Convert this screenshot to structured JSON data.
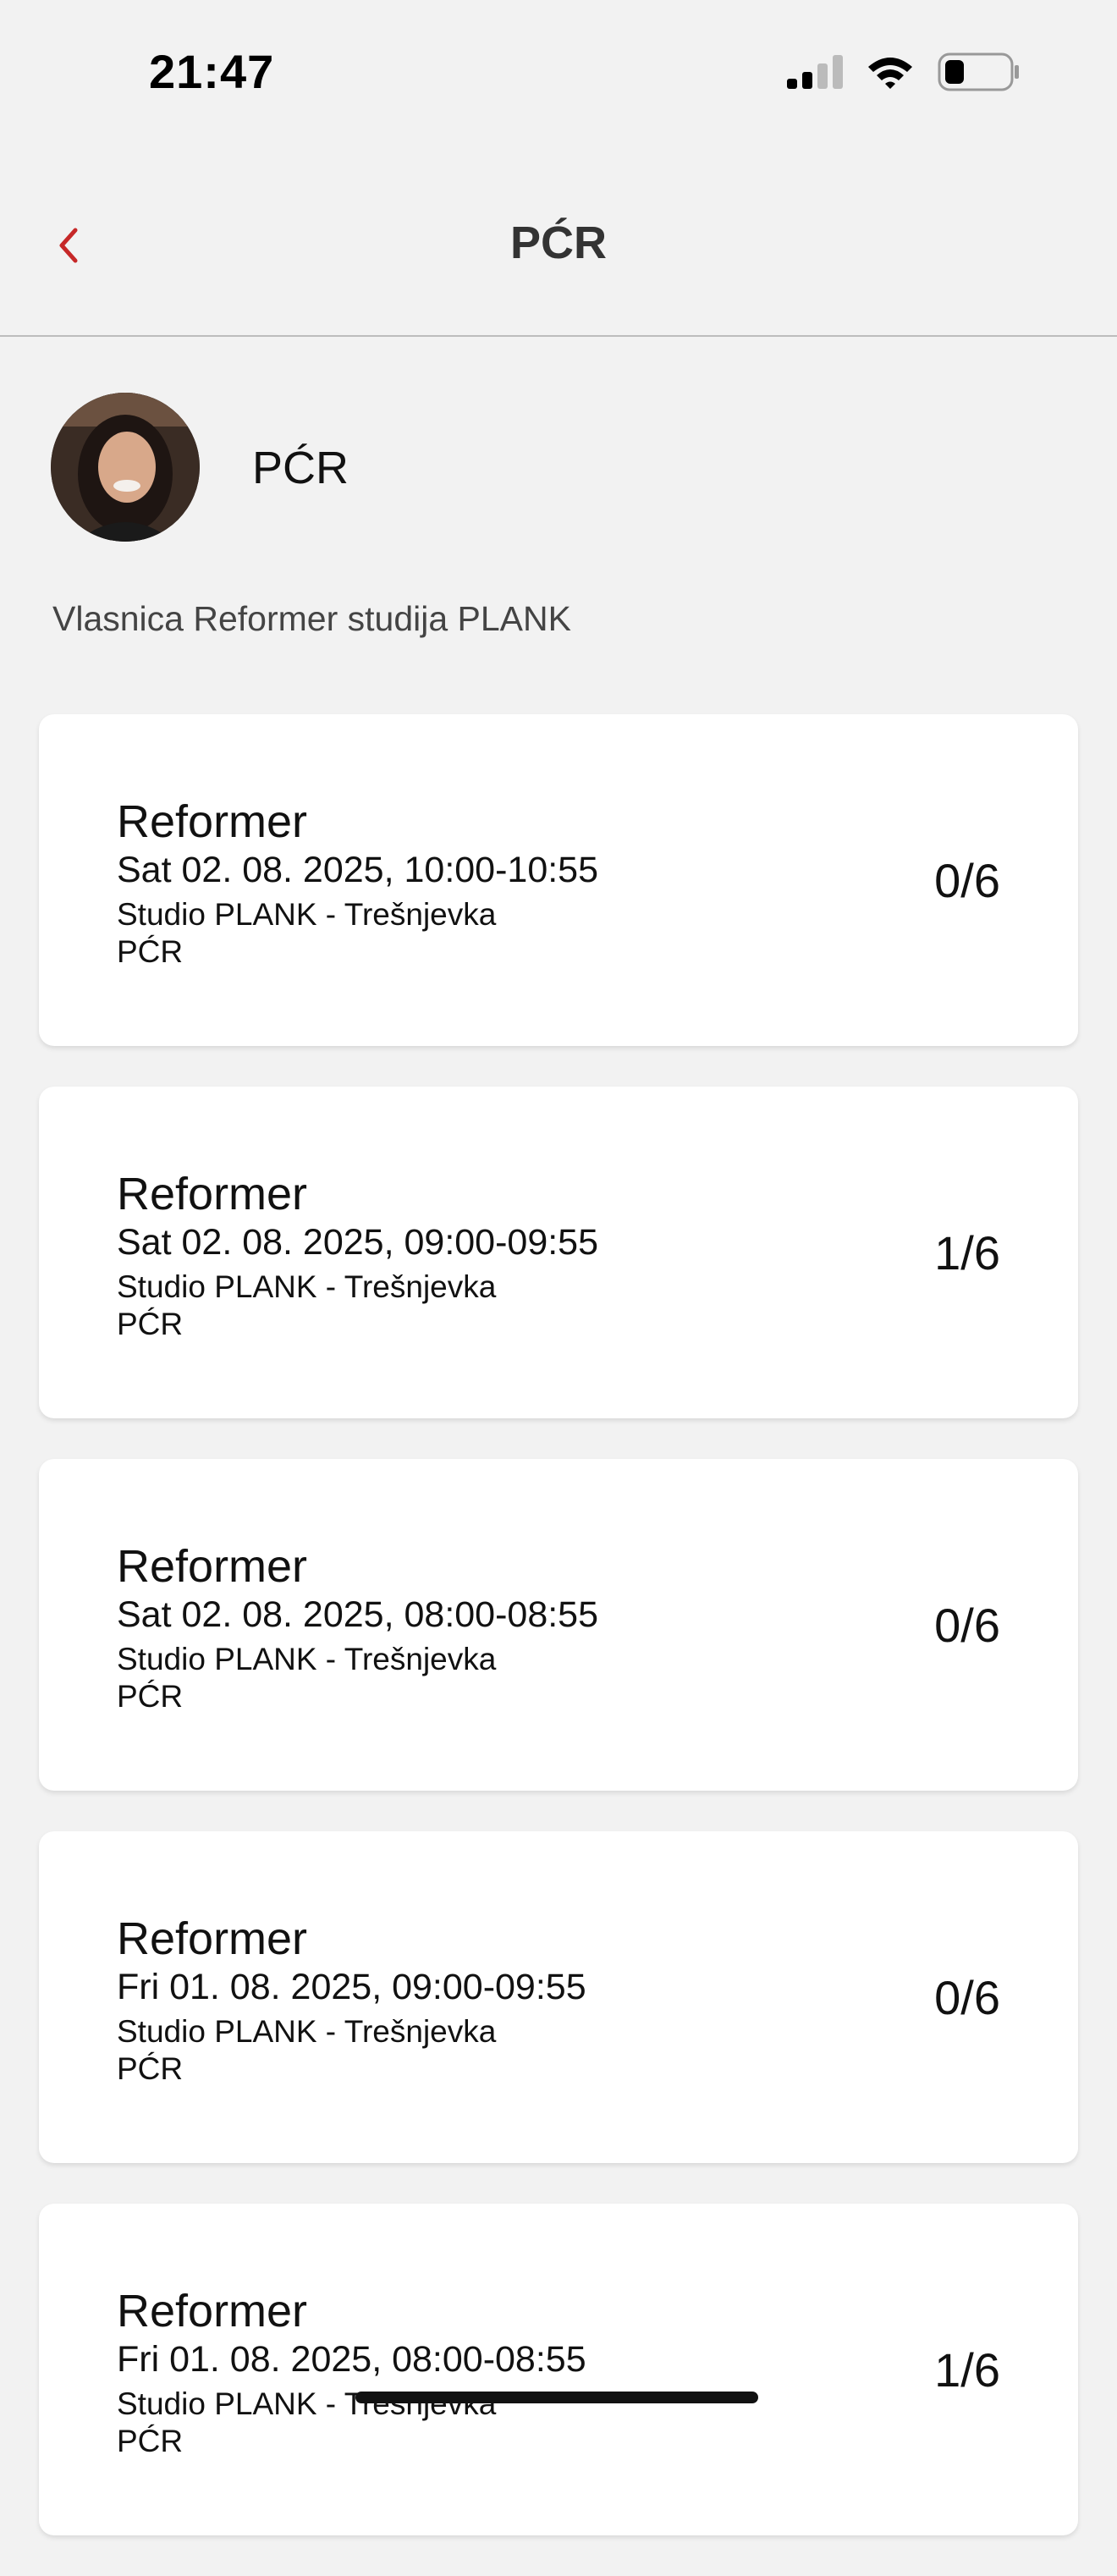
{
  "status_bar": {
    "time": "21:47",
    "icons": [
      "cellular-signal-icon",
      "wifi-icon",
      "battery-icon"
    ]
  },
  "nav": {
    "back_icon": "chevron-left-icon",
    "title": "PĆR",
    "accent_color": "#c62828"
  },
  "profile": {
    "name": "PĆR",
    "bio": "Vlasnica Reformer studija PLANK"
  },
  "classes": [
    {
      "title": "Reformer",
      "datetime": "Sat 02. 08. 2025, 10:00-10:55",
      "location": "Studio PLANK - Trešnjevka",
      "instructor": "PĆR",
      "capacity": "0/6"
    },
    {
      "title": "Reformer",
      "datetime": "Sat 02. 08. 2025, 09:00-09:55",
      "location": "Studio PLANK - Trešnjevka",
      "instructor": "PĆR",
      "capacity": "1/6"
    },
    {
      "title": "Reformer",
      "datetime": "Sat 02. 08. 2025, 08:00-08:55",
      "location": "Studio PLANK - Trešnjevka",
      "instructor": "PĆR",
      "capacity": "0/6"
    },
    {
      "title": "Reformer",
      "datetime": "Fri 01. 08. 2025, 09:00-09:55",
      "location": "Studio PLANK - Trešnjevka",
      "instructor": "PĆR",
      "capacity": "0/6"
    },
    {
      "title": "Reformer",
      "datetime": "Fri 01. 08. 2025, 08:00-08:55",
      "location": "Studio PLANK - Trešnjevka",
      "instructor": "PĆR",
      "capacity": "1/6"
    }
  ]
}
